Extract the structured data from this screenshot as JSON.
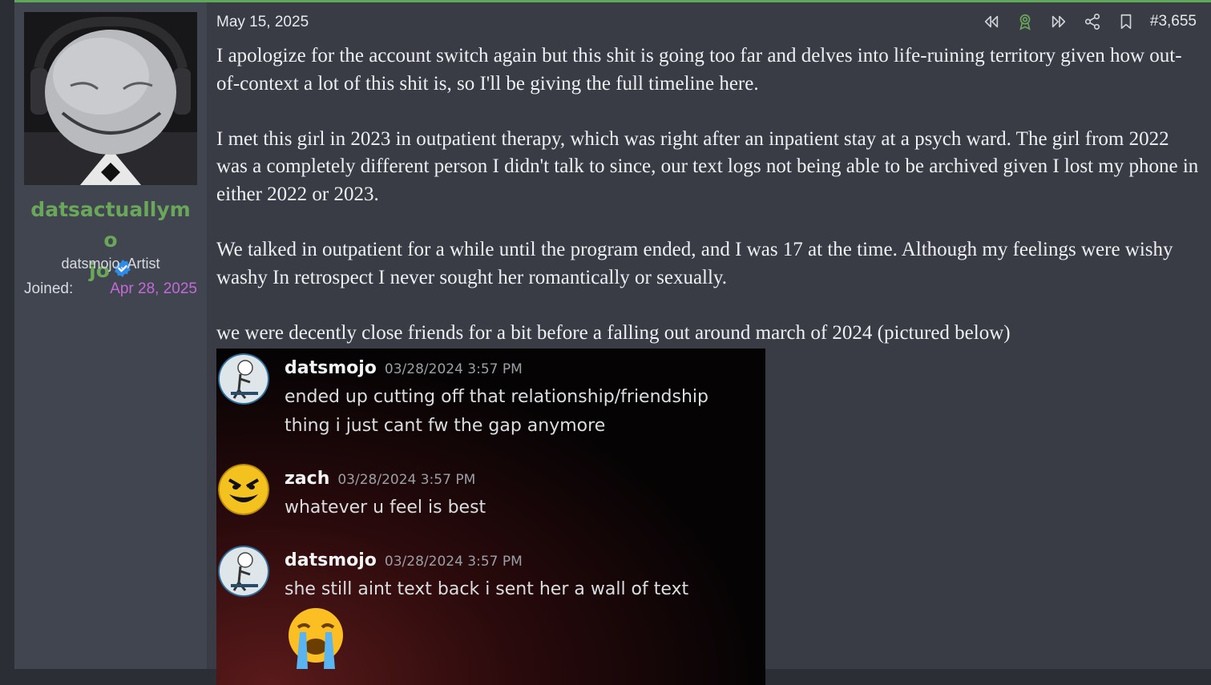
{
  "user": {
    "username_part1": "datsactuallymo",
    "username_part2": "jo",
    "title": "datsmojo, Artist",
    "joined_label": "Joined:",
    "joined_value": "Apr 28, 2025",
    "verified_icon": "verified-badge-icon"
  },
  "post": {
    "date": "May 15, 2025",
    "number": "#3,655",
    "paragraphs": [
      "I apologize for the account switch again but this shit is going too far and delves into life-ruining territory given how out-of-context a lot of this shit is, so I'll be giving the full timeline here.",
      "I met this girl in 2023 in outpatient therapy, which was right after an inpatient stay at a psych ward. The girl from 2022 was a completely different person I didn't talk to since, our text logs not being able to be archived given I lost my phone in either 2022 or 2023.",
      "We talked in outpatient for a while until the program ended, and I was 17 at the time. Although my feelings were wishy washy In retrospect I never sought her romantically or sexually.",
      "we were decently close friends for a bit before a falling out around march of 2024 (pictured below)"
    ],
    "action_icons": [
      "rewind-icon",
      "award-icon",
      "fast-forward-icon",
      "share-icon",
      "bookmark-icon"
    ]
  },
  "screenshot": {
    "messages": [
      {
        "name": "datsmojo",
        "time": "03/28/2024 3:57 PM",
        "lines": [
          "ended up cutting off that relationship/friendship",
          "thing  i just cant fw the gap anymore"
        ]
      },
      {
        "name": "zach",
        "time": "03/28/2024 3:57 PM",
        "lines": [
          "whatever u feel is best"
        ]
      },
      {
        "name": "datsmojo",
        "time": "03/28/2024 3:57 PM",
        "lines": [
          "she still aint text back i sent her a wall of text"
        ]
      }
    ]
  },
  "colors": {
    "accent_green": "#5ea857",
    "username": "#6aa75a",
    "joined_date": "#c46ad8"
  }
}
